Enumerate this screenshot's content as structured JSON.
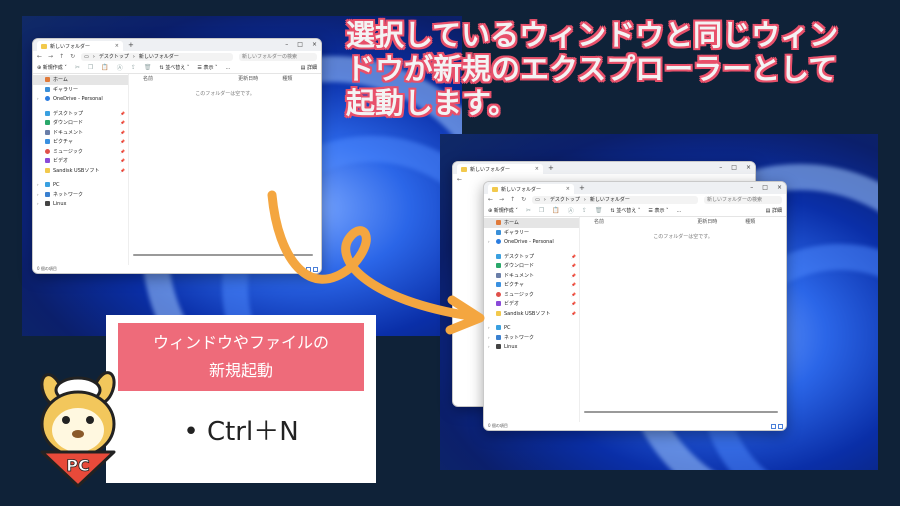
{
  "headline": {
    "line1": "選択しているウィンドウと同じウィン",
    "line2": "ドウが新規のエクスプローラーとして",
    "line3": "起動します。"
  },
  "card": {
    "title_line1": "ウィンドウやファイルの",
    "title_line2": "新規起動",
    "shortcut": "• Ctrl＋N"
  },
  "mascot": {
    "badge": "PC"
  },
  "explorer": {
    "tab_title": "新しいフォルダー",
    "path_desktop": "デスクトップ",
    "path_folder": "新しいフォルダー",
    "search_placeholder": "新しいフォルダーの検索",
    "new_label": "新規作成",
    "sort_label": "並べ替え",
    "view_label": "表示",
    "more_label": "...",
    "details_label": "詳細",
    "col_name": "名前",
    "col_date": "更新日時",
    "col_type": "種類",
    "empty_text": "このフォルダーは空です。",
    "status_text": "0 個の項目",
    "sidebar": {
      "home": "ホーム",
      "gallery": "ギャラリー",
      "onedrive": "OneDrive - Personal",
      "desktop": "デスクトップ",
      "downloads": "ダウンロード",
      "documents": "ドキュメント",
      "pictures": "ピクチャ",
      "music": "ミュージック",
      "videos": "ビデオ",
      "usb": "Sandisk USBソフト",
      "pc": "PC",
      "network": "ネットワーク",
      "linux": "Linux"
    }
  },
  "colors": {
    "accent_pink": "#ee6b7a",
    "arrow_orange": "#f4a640",
    "headline_outline": "#e8506a"
  }
}
